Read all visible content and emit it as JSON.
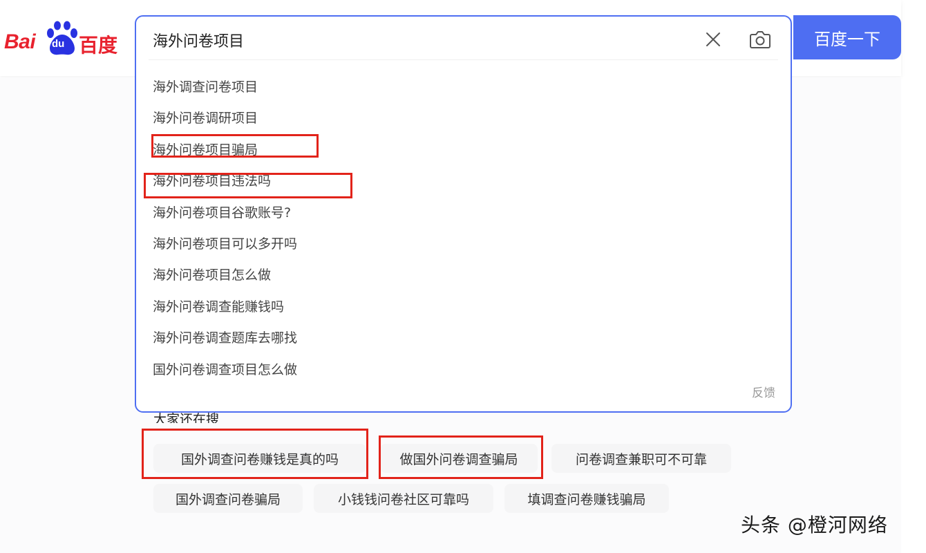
{
  "logo": {
    "latin": "Bai",
    "du": "du",
    "chinese": "百度"
  },
  "search": {
    "query": "海外问卷项目",
    "submit_label": "百度一下",
    "clear_icon": "close-icon",
    "camera_icon": "camera-icon"
  },
  "suggestions": [
    "海外调查问卷项目",
    "海外问卷调研项目",
    "海外问卷项目骗局",
    "海外问卷项目违法吗",
    "海外问卷项目谷歌账号?",
    "海外问卷项目可以多开吗",
    "海外问卷项目怎么做",
    "海外问卷调查能赚钱吗",
    "海外问卷调查题库去哪找",
    "国外问卷调查项目怎么做"
  ],
  "feedback_label": "反馈",
  "related": {
    "heading": "大家还在搜",
    "items": [
      "国外调查问卷赚钱是真的吗",
      "做国外问卷调查骗局",
      "问卷调查兼职可不可靠",
      "国外调查问卷骗局",
      "小钱钱问卷社区可靠吗",
      "填调查问卷赚钱骗局"
    ]
  },
  "watermark": "头条 @橙河网络",
  "colors": {
    "brand_blue": "#4e6ef2",
    "baidu_red": "#e8222e",
    "annotation_red": "#e2231a"
  }
}
